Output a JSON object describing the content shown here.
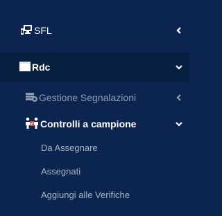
{
  "menu": {
    "sfl": {
      "label": "SFL",
      "icon": "folder-monitor-icon",
      "indicator": "chevron-left"
    },
    "rdc": {
      "label": "Rdc",
      "icon": "window-icon",
      "indicator": "chevron-down"
    },
    "gestione": {
      "label": "Gestione Segnalazioni",
      "icon": "server-gear-icon",
      "indicator": "chevron-left"
    },
    "controlli": {
      "label": "Controlli a campione",
      "icon": "people-checklist-icon",
      "indicator": "chevron-down",
      "children": [
        {
          "label": "Da Assegnare"
        },
        {
          "label": "Assegnati"
        },
        {
          "label": "Aggiungi alle Verifiche"
        }
      ]
    }
  },
  "colors": {
    "background": "#0b2550",
    "active_background": "#08203f",
    "text_primary": "#ffffff",
    "text_muted": "#8f9cad",
    "text_sub": "#a8b3c2"
  }
}
